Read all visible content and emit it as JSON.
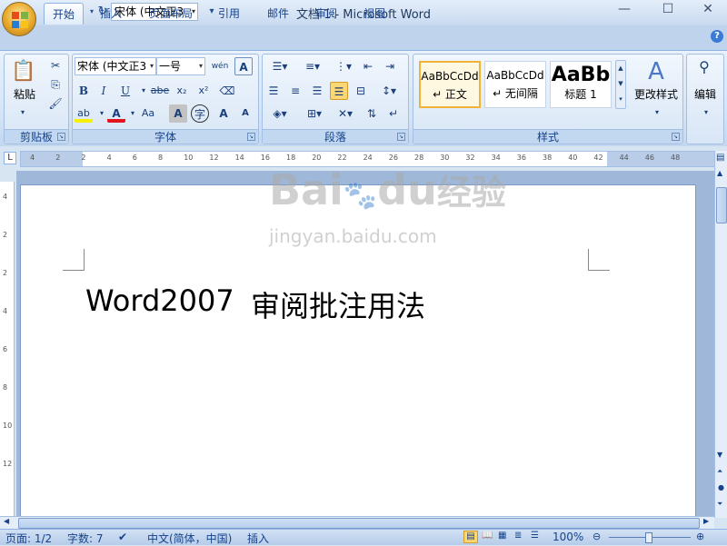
{
  "window": {
    "title": "文档 1 - Microsoft Word",
    "minimize": "—",
    "maximize": "☐",
    "close": "✕"
  },
  "qat": {
    "save": "💾",
    "undo": "↶",
    "redo": "↻",
    "font_value": "宋体 (中文正3",
    "customize": "▾"
  },
  "tabs": [
    {
      "label": "开始"
    },
    {
      "label": "插入"
    },
    {
      "label": "页面布局"
    },
    {
      "label": "引用"
    },
    {
      "label": "邮件"
    },
    {
      "label": "审阅"
    },
    {
      "label": "视图"
    }
  ],
  "help": "?",
  "ribbon": {
    "clipboard": {
      "label": "剪贴板",
      "paste": "粘贴"
    },
    "font": {
      "label": "字体",
      "font_name": "宋体 (中文正3",
      "font_size": "一号",
      "bold": "B",
      "italic": "I",
      "underline": "U",
      "strike": "abe",
      "subscript": "x₂",
      "superscript": "x²",
      "highlight": "ab",
      "color": "A",
      "case": "Aa",
      "grow": "A",
      "shrink": "A"
    },
    "paragraph": {
      "label": "段落"
    },
    "styles": {
      "label": "样式",
      "items": [
        {
          "sample": "AaBbCcDd",
          "name": "↵ 正文"
        },
        {
          "sample": "AaBbCcDd",
          "name": "↵ 无间隔"
        },
        {
          "sample": "AaBb",
          "name": "标题 1"
        }
      ],
      "change_styles": "更改样式"
    },
    "editing": {
      "label": "编辑"
    }
  },
  "ruler": {
    "h_ticks": [
      "4",
      "2",
      "2",
      "4",
      "6",
      "8",
      "10",
      "12",
      "14",
      "16",
      "18",
      "20",
      "22",
      "24",
      "26",
      "28",
      "30",
      "32",
      "34",
      "36",
      "38",
      "40",
      "42",
      "44",
      "46",
      "48"
    ],
    "v_ticks": [
      "4",
      "2",
      "2",
      "4",
      "6",
      "8",
      "10",
      "12"
    ]
  },
  "document": {
    "text_latin": "Word2007",
    "text_cn": "审阅批注用法"
  },
  "watermark": {
    "brand": "Bai",
    "brand2": "du",
    "cn": "经验",
    "url": "jingyan.baidu.com"
  },
  "status": {
    "page": "页面: 1/2",
    "words": "字数: 7",
    "language": "中文(简体，中国)",
    "mode": "插入",
    "zoom": "100%"
  }
}
